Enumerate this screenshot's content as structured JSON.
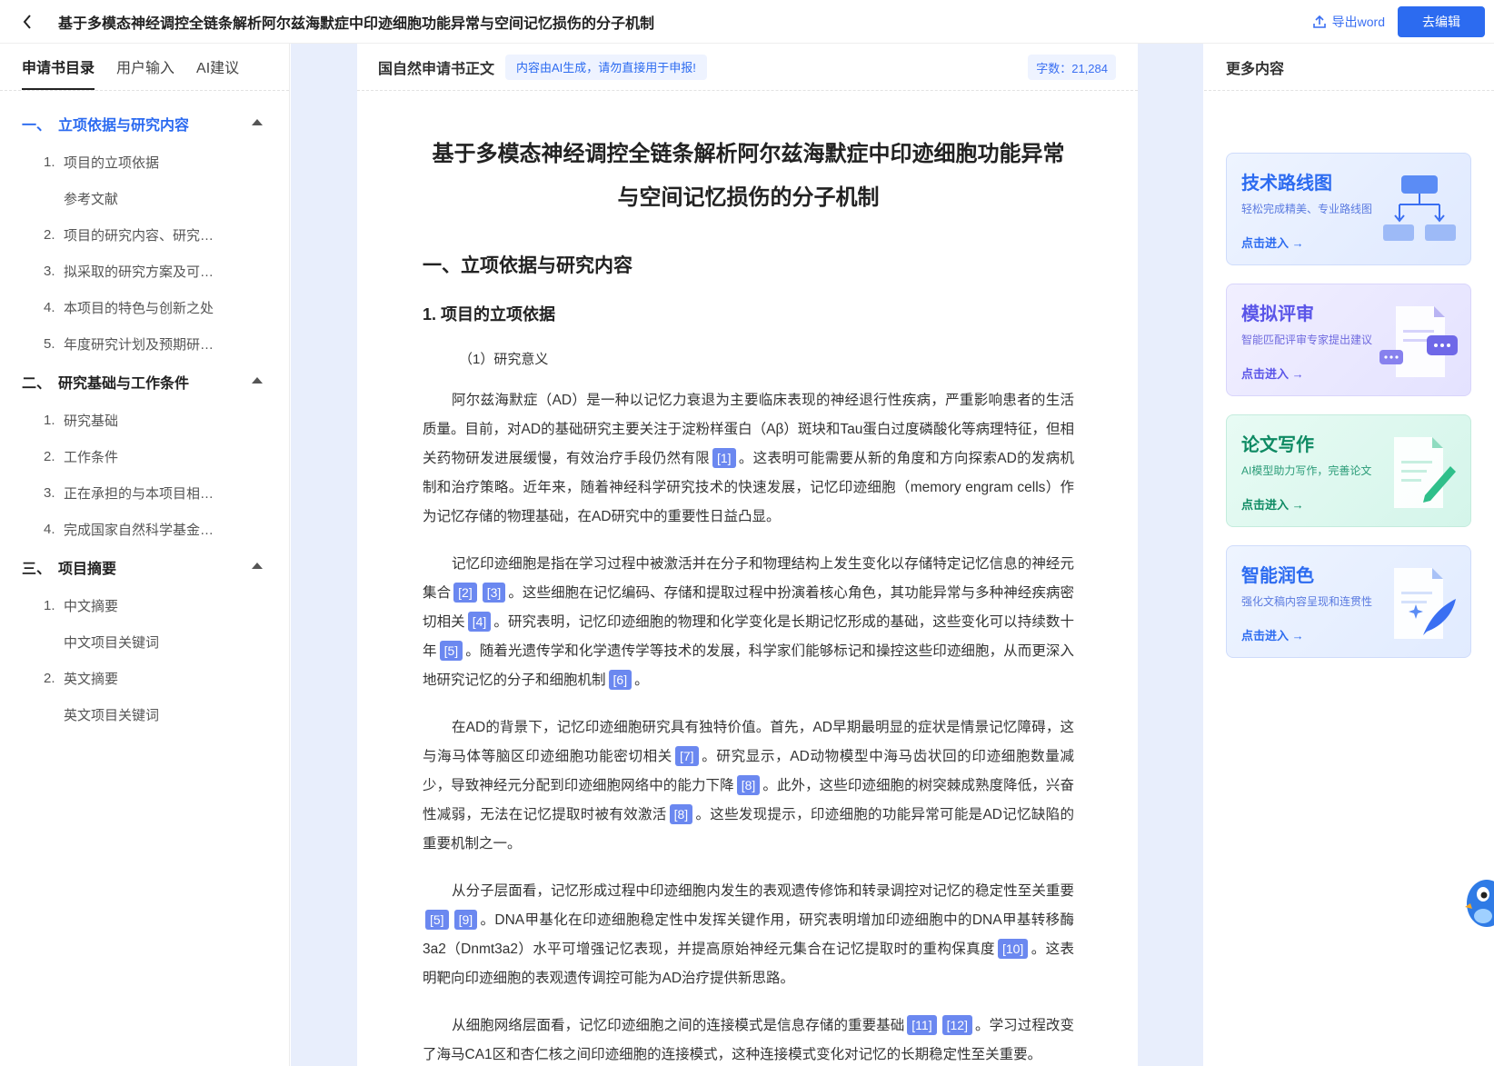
{
  "header": {
    "title": "基于多模态神经调控全链条解析阿尔兹海默症中印迹细胞功能异常与空间记忆损伤的分子机制",
    "export_label": "导出word",
    "edit_label": "去编辑"
  },
  "left": {
    "tabs": [
      "申请书目录",
      "用户输入",
      "AI建议"
    ],
    "toc": [
      {
        "num": "一、",
        "label": "立项依据与研究内容",
        "items": [
          {
            "num": "1.",
            "label": "项目的立项依据"
          },
          {
            "num": "",
            "label": "参考文献"
          },
          {
            "num": "2.",
            "label": "项目的研究内容、研究…"
          },
          {
            "num": "3.",
            "label": "拟采取的研究方案及可…"
          },
          {
            "num": "4.",
            "label": "本项目的特色与创新之处"
          },
          {
            "num": "5.",
            "label": "年度研究计划及预期研…"
          }
        ]
      },
      {
        "num": "二、",
        "label": "研究基础与工作条件",
        "items": [
          {
            "num": "1.",
            "label": "研究基础"
          },
          {
            "num": "2.",
            "label": "工作条件"
          },
          {
            "num": "3.",
            "label": "正在承担的与本项目相…"
          },
          {
            "num": "4.",
            "label": "完成国家自然科学基金…"
          }
        ]
      },
      {
        "num": "三、",
        "label": "项目摘要",
        "items": [
          {
            "num": "1.",
            "label": "中文摘要"
          },
          {
            "num": "",
            "label": "中文项目关键词"
          },
          {
            "num": "2.",
            "label": "英文摘要"
          },
          {
            "num": "",
            "label": "英文项目关键词"
          }
        ]
      }
    ]
  },
  "paper": {
    "head_label": "国自然申请书正文",
    "ai_notice": "内容由AI生成，请勿直接用于申报!",
    "word_count": "字数：21,284",
    "title_line1": "基于多模态神经调控全链条解析阿尔兹海默症中印迹细胞功能异常",
    "title_line2": "与空间记忆损伤的分子机制",
    "h1": "一、立项依据与研究内容",
    "h2": "1. 项目的立项依据",
    "h3": "（1）研究意义",
    "p1": {
      "t1": "阿尔兹海默症（AD）是一种以记忆力衰退为主要临床表现的神经退行性疾病，严重影响患者的生活质量。目前，对AD的基础研究主要关注于淀粉样蛋白（Aβ）斑块和Tau蛋白过度磷酸化等病理特征，但相关药物研发进展缓慢，有效治疗手段仍然有限",
      "c1": "[1]",
      "t2": "。这表明可能需要从新的角度和方向探索AD的发病机制和治疗策略。近年来，随着神经科学研究技术的快速发展，记忆印迹细胞（memory engram cells）作为记忆存储的物理基础，在AD研究中的重要性日益凸显。"
    },
    "p2": {
      "t1": "记忆印迹细胞是指在学习过程中被激活并在分子和物理结构上发生变化以存储特定记忆信息的神经元集合",
      "c1": "[2]",
      "c2": "[3]",
      "t2": "。这些细胞在记忆编码、存储和提取过程中扮演着核心角色，其功能异常与多种神经疾病密切相关",
      "c3": "[4]",
      "t3": "。研究表明，记忆印迹细胞的物理和化学变化是长期记忆形成的基础，这些变化可以持续数十年",
      "c4": "[5]",
      "t4": "。随着光遗传学和化学遗传学等技术的发展，科学家们能够标记和操控这些印迹细胞，从而更深入地研究记忆的分子和细胞机制",
      "c5": "[6]",
      "t5": "。"
    },
    "p3": {
      "t1": "在AD的背景下，记忆印迹细胞研究具有独特价值。首先，AD早期最明显的症状是情景记忆障碍，这与海马体等脑区印迹细胞功能密切相关",
      "c1": "[7]",
      "t2": "。研究显示，AD动物模型中海马齿状回的印迹细胞数量减少，导致神经元分配到印迹细胞网络中的能力下降",
      "c2": "[8]",
      "t3": "。此外，这些印迹细胞的树突棘成熟度降低，兴奋性减弱，无法在记忆提取时被有效激活",
      "c3": "[8]",
      "t4": "。这些发现提示，印迹细胞的功能异常可能是AD记忆缺陷的重要机制之一。"
    },
    "p4": {
      "t1": "从分子层面看，记忆形成过程中印迹细胞内发生的表观遗传修饰和转录调控对记忆的稳定性至关重要",
      "c1": "[5]",
      "c2": "[9]",
      "t2": "。DNA甲基化在印迹细胞稳定性中发挥关键作用，研究表明增加印迹细胞中的DNA甲基转移酶3a2（Dnmt3a2）水平可增强记忆表现，并提高原始神经元集合在记忆提取时的重构保真度",
      "c3": "[10]",
      "t3": "。这表明靶向印迹细胞的表观遗传调控可能为AD治疗提供新思路。"
    },
    "p5": {
      "t1": "从细胞网络层面看，记忆印迹细胞之间的连接模式是信息存储的重要基础",
      "c1": "[11]",
      "c2": "[12]",
      "t2": "。学习过程改变了海马CA1区和杏仁核之间印迹细胞的连接模式，这种连接模式变化对记忆的长期稳定性至关重要。"
    }
  },
  "right": {
    "head": "更多内容",
    "cards": [
      {
        "title": "技术路线图",
        "desc": "轻松完成精美、专业路线图",
        "link": "点击进入 →"
      },
      {
        "title": "模拟评审",
        "desc": "智能匹配评审专家提出建议",
        "link": "点击进入 →"
      },
      {
        "title": "论文写作",
        "desc": "AI模型助力写作，完善论文",
        "link": "点击进入 →"
      },
      {
        "title": "智能润色",
        "desc": "强化文稿内容呈现和连贯性",
        "link": "点击进入 →"
      }
    ]
  },
  "colors": {
    "accent": "#2c6bf0",
    "cite": "#6b88f0",
    "center_bg": "#e8eefc"
  }
}
